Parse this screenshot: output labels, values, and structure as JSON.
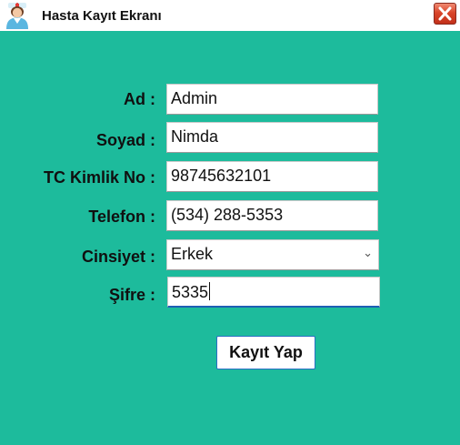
{
  "window": {
    "title": "Hasta Kayıt Ekranı",
    "app_icon": "nurse-user-icon",
    "close_icon": "close-icon",
    "background_color": "#1dbb9c"
  },
  "form": {
    "ad_label": "Ad :",
    "ad_value": "Admin",
    "soyad_label": "Soyad :",
    "soyad_value": "Nimda",
    "tc_label": "TC Kimlik No :",
    "tc_value": "98745632101",
    "telefon_label": "Telefon :",
    "telefon_value": "(534) 288-5353",
    "cinsiyet_label": "Cinsiyet :",
    "cinsiyet_value": "Erkek",
    "sifre_label": "Şifre :",
    "sifre_value": "5335",
    "submit_label": "Kayıt Yap"
  }
}
